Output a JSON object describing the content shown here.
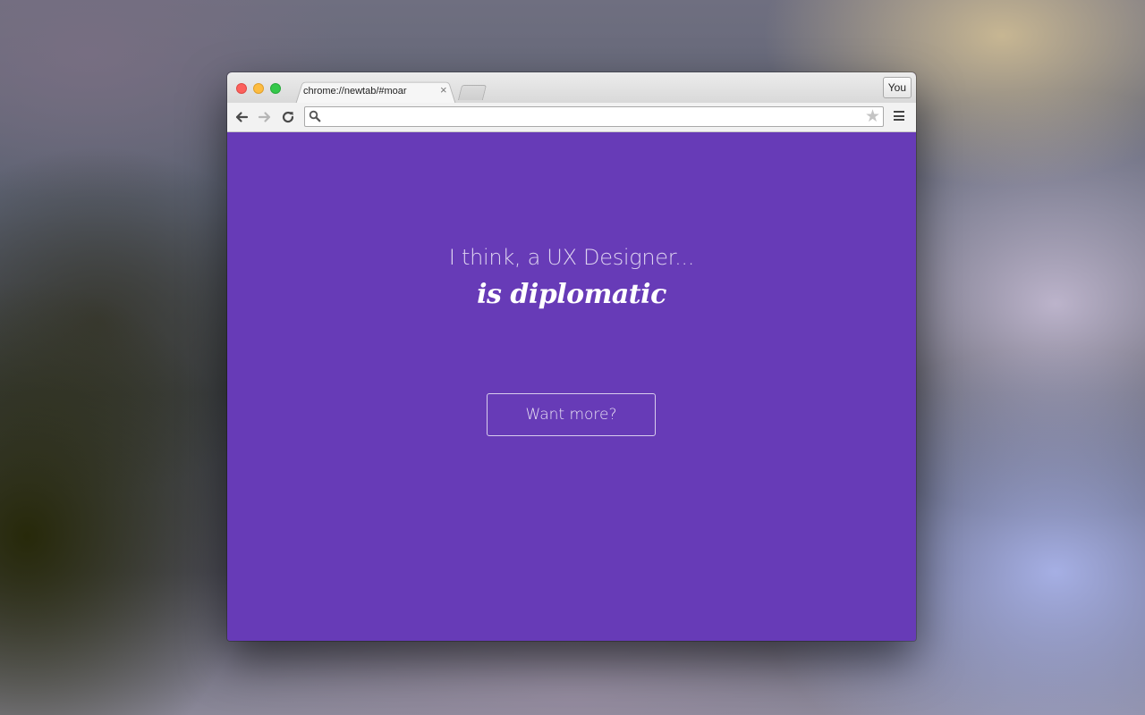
{
  "browser": {
    "tab": {
      "title": "chrome://newtab/#moar",
      "close_icon": "×"
    },
    "profile_label": "You",
    "omnibox": {
      "value": "",
      "placeholder": ""
    },
    "icons": {
      "back": "arrow-left-icon",
      "forward": "arrow-right-icon",
      "reload": "reload-icon",
      "search": "search-icon",
      "star": "star-icon",
      "menu": "hamburger-menu-icon",
      "star_glyph": "★"
    }
  },
  "page": {
    "background_color": "#673bb7",
    "line_one": "I think, a UX Designer...",
    "line_two": "is diplomatic",
    "button_label": "Want more?"
  }
}
